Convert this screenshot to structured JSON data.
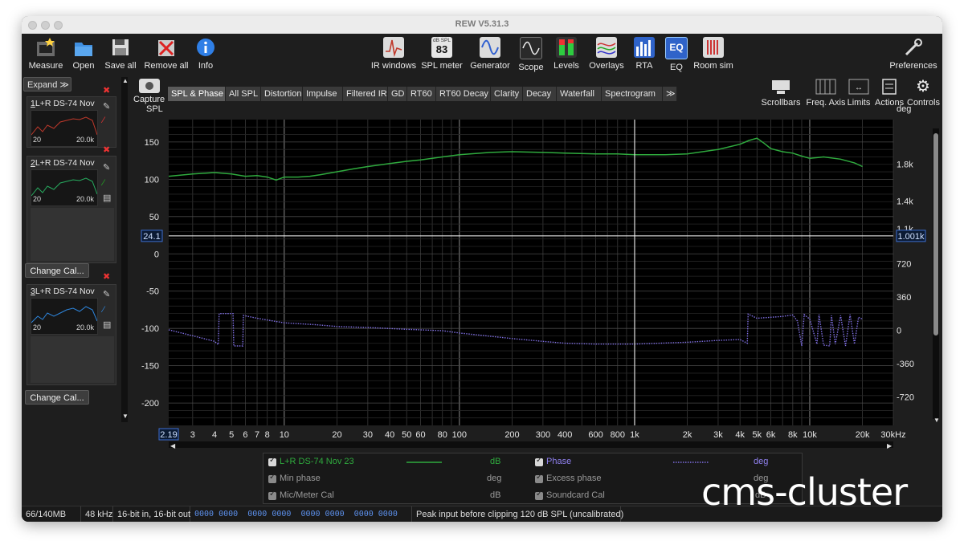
{
  "window": {
    "title": "REW V5.31.3"
  },
  "toolbar": {
    "left": [
      {
        "name": "measure",
        "label": "Measure",
        "icon": "measure-icon"
      },
      {
        "name": "open",
        "label": "Open",
        "icon": "folder-icon"
      },
      {
        "name": "save-all",
        "label": "Save all",
        "icon": "save-icon"
      },
      {
        "name": "remove-all",
        "label": "Remove all",
        "icon": "remove-icon"
      },
      {
        "name": "info",
        "label": "Info",
        "icon": "info-icon"
      }
    ],
    "center": [
      {
        "name": "ir-windows",
        "label": "IR windows"
      },
      {
        "name": "spl-meter",
        "label": "SPL meter",
        "badge_top": "dB SPL",
        "badge_value": "83"
      },
      {
        "name": "generator",
        "label": "Generator"
      },
      {
        "name": "scope",
        "label": "Scope"
      },
      {
        "name": "levels",
        "label": "Levels"
      },
      {
        "name": "overlays",
        "label": "Overlays"
      },
      {
        "name": "rta",
        "label": "RTA"
      },
      {
        "name": "eq",
        "label": "EQ",
        "badge_value": "EQ"
      },
      {
        "name": "room-sim",
        "label": "Room sim"
      }
    ],
    "preferences": "Preferences"
  },
  "sidebar": {
    "expand_label": "Expand",
    "expand_glyph": "≫",
    "change_cal_label": "Change Cal...",
    "measurements": [
      {
        "index": "1",
        "name": "L+R DS-74 Nov",
        "color": "#c0392b",
        "f_lo": "20",
        "f_hi": "20.0k"
      },
      {
        "index": "2",
        "name": "L+R DS-74 Nov",
        "color": "#27ae60",
        "f_lo": "20",
        "f_hi": "20.0k"
      },
      {
        "index": "3",
        "name": "L+R DS-74 Nov",
        "color": "#2e86de",
        "f_lo": "20",
        "f_hi": "20.0k"
      }
    ]
  },
  "capture": {
    "label": "Capture"
  },
  "tabs": [
    "SPL & Phase",
    "All SPL",
    "Distortion",
    "Impulse",
    "Filtered IR",
    "GD",
    "RT60",
    "RT60 Decay",
    "Clarity",
    "Decay",
    "Waterfall",
    "Spectrogram",
    "≫"
  ],
  "active_tab": "SPL & Phase",
  "right_tools": [
    {
      "name": "scrollbars",
      "label": "Scrollbars"
    },
    {
      "name": "freq-axis",
      "label": "Freq. Axis"
    },
    {
      "name": "limits",
      "label": "Limits"
    },
    {
      "name": "actions",
      "label": "Actions"
    },
    {
      "name": "controls",
      "label": "Controls"
    }
  ],
  "plot": {
    "left_axis_title": "SPL",
    "right_axis_title": "deg",
    "cursor_left": "24.1",
    "cursor_right": "1.001k",
    "freq_start_label": "2.19"
  },
  "chart_data": {
    "type": "line",
    "x_scale": "log",
    "xlim": [
      2.19,
      30000
    ],
    "ylim": [
      -230,
      180
    ],
    "y2lim": [
      -1030,
      2280
    ],
    "y_ticks": [
      150,
      100,
      50,
      0,
      -50,
      -100,
      -150,
      -200
    ],
    "y2_ticks": [
      {
        "v": 1800,
        "label": "1.8k"
      },
      {
        "v": 1400,
        "label": "1.4k"
      },
      {
        "v": 1100,
        "label": "1.1k"
      },
      {
        "v": 720,
        "label": "720"
      },
      {
        "v": 360,
        "label": "360"
      },
      {
        "v": 0,
        "label": "0"
      },
      {
        "v": -360,
        "label": "-360"
      },
      {
        "v": -720,
        "label": "-720"
      }
    ],
    "x_ticks": [
      {
        "v": 3,
        "label": "3"
      },
      {
        "v": 4,
        "label": "4"
      },
      {
        "v": 5,
        "label": "5"
      },
      {
        "v": 6,
        "label": "6"
      },
      {
        "v": 7,
        "label": "7"
      },
      {
        "v": 8,
        "label": "8"
      },
      {
        "v": 10,
        "label": "10"
      },
      {
        "v": 20,
        "label": "20"
      },
      {
        "v": 30,
        "label": "30"
      },
      {
        "v": 40,
        "label": "40"
      },
      {
        "v": 50,
        "label": "50"
      },
      {
        "v": 60,
        "label": "60"
      },
      {
        "v": 80,
        "label": "80"
      },
      {
        "v": 100,
        "label": "100"
      },
      {
        "v": 200,
        "label": "200"
      },
      {
        "v": 300,
        "label": "300"
      },
      {
        "v": 400,
        "label": "400"
      },
      {
        "v": 600,
        "label": "600"
      },
      {
        "v": 800,
        "label": "800"
      },
      {
        "v": 1000,
        "label": "1k"
      },
      {
        "v": 2000,
        "label": "2k"
      },
      {
        "v": 3000,
        "label": "3k"
      },
      {
        "v": 4000,
        "label": "4k"
      },
      {
        "v": 5000,
        "label": "5k"
      },
      {
        "v": 6000,
        "label": "6k"
      },
      {
        "v": 8000,
        "label": "8k"
      },
      {
        "v": 10000,
        "label": "10k"
      },
      {
        "v": 20000,
        "label": "20k"
      },
      {
        "v": 30000,
        "label": "30kHz"
      }
    ],
    "cursor": {
      "x": 1001,
      "y": 24.1
    },
    "series": [
      {
        "name": "L+R DS-74 Nov 23",
        "axis": "left",
        "color": "#2faa3e",
        "style": "solid",
        "points": [
          [
            2.19,
            104
          ],
          [
            3,
            107
          ],
          [
            4,
            109
          ],
          [
            5,
            107
          ],
          [
            6,
            104
          ],
          [
            7,
            105
          ],
          [
            8,
            103
          ],
          [
            9,
            99
          ],
          [
            10,
            103
          ],
          [
            12,
            103
          ],
          [
            14,
            104
          ],
          [
            16,
            106
          ],
          [
            20,
            110
          ],
          [
            25,
            114
          ],
          [
            30,
            117
          ],
          [
            40,
            121
          ],
          [
            50,
            124
          ],
          [
            60,
            126
          ],
          [
            80,
            130
          ],
          [
            100,
            133
          ],
          [
            150,
            136
          ],
          [
            200,
            137
          ],
          [
            300,
            136
          ],
          [
            400,
            135
          ],
          [
            600,
            134
          ],
          [
            800,
            134
          ],
          [
            1000,
            133
          ],
          [
            1500,
            133
          ],
          [
            2000,
            134
          ],
          [
            3000,
            140
          ],
          [
            4000,
            147
          ],
          [
            4500,
            152
          ],
          [
            5000,
            155
          ],
          [
            5500,
            148
          ],
          [
            6000,
            141
          ],
          [
            7000,
            137
          ],
          [
            8000,
            135
          ],
          [
            9000,
            131
          ],
          [
            10000,
            128
          ],
          [
            12000,
            130
          ],
          [
            15000,
            127
          ],
          [
            18000,
            122
          ],
          [
            20000,
            117
          ]
        ]
      },
      {
        "name": "Phase",
        "axis": "right",
        "color": "#7e6ee0",
        "style": "dotted",
        "points": [
          [
            2.19,
            5
          ],
          [
            3,
            -60
          ],
          [
            4,
            -120
          ],
          [
            4.2,
            -155
          ],
          [
            4.25,
            180
          ],
          [
            5.1,
            180
          ],
          [
            5.15,
            -170
          ],
          [
            5.8,
            -170
          ],
          [
            5.85,
            160
          ],
          [
            7,
            130
          ],
          [
            10,
            80
          ],
          [
            15,
            60
          ],
          [
            20,
            40
          ],
          [
            30,
            30
          ],
          [
            50,
            10
          ],
          [
            80,
            -5
          ],
          [
            100,
            -30
          ],
          [
            200,
            -90
          ],
          [
            300,
            -120
          ],
          [
            400,
            -140
          ],
          [
            600,
            -150
          ],
          [
            1000,
            -150
          ],
          [
            2000,
            -130
          ],
          [
            3000,
            -110
          ],
          [
            4000,
            -100
          ],
          [
            4400,
            -140
          ],
          [
            4450,
            175
          ],
          [
            5000,
            130
          ],
          [
            6000,
            140
          ],
          [
            7000,
            150
          ],
          [
            8000,
            165
          ],
          [
            8500,
            100
          ],
          [
            9000,
            -170
          ],
          [
            9300,
            170
          ],
          [
            10000,
            120
          ],
          [
            11000,
            -150
          ],
          [
            11300,
            170
          ],
          [
            12000,
            -160
          ],
          [
            13000,
            -170
          ],
          [
            13300,
            160
          ],
          [
            14000,
            -150
          ],
          [
            15000,
            160
          ],
          [
            16000,
            -170
          ],
          [
            17000,
            170
          ],
          [
            18000,
            -150
          ],
          [
            19000,
            140
          ],
          [
            20000,
            120
          ]
        ]
      }
    ]
  },
  "legend": {
    "items": [
      {
        "label": "L+R DS-74 Nov 23",
        "unit": "dB",
        "color": "#2faa3e",
        "style": "solid"
      },
      {
        "label": "Phase",
        "unit": "deg",
        "color": "#7e6ee0",
        "style": "dotted"
      },
      {
        "label": "Min phase",
        "unit": "deg"
      },
      {
        "label": "Excess phase",
        "unit": "deg"
      },
      {
        "label": "Mic/Meter Cal",
        "unit": "dB"
      },
      {
        "label": "Soundcard Cal",
        "unit": "dB"
      }
    ]
  },
  "status": {
    "memory": "66/140MB",
    "rate": "48 kHz",
    "bits": "16-bit in, 16-bit out",
    "meters": "0000 0000  0000 0000  0000 0000  0000 0000",
    "message": "Peak input before clipping 120 dB SPL (uncalibrated)"
  },
  "watermark": "cms-cluster",
  "colors": {
    "accent_green": "#2faa3e",
    "accent_purple": "#7e6ee0",
    "cursor_box": "#3d6fd1",
    "meter_digits": "#5b8ee8"
  }
}
